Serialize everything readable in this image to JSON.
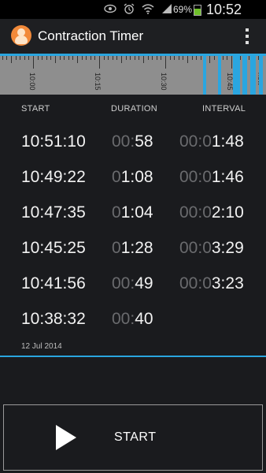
{
  "status_bar": {
    "battery_pct": "69%",
    "time": "10:52 AM",
    "battery_level": 0.69,
    "icons": [
      "eye-icon",
      "alarm-icon",
      "wifi-icon",
      "signal-icon",
      "battery-icon"
    ]
  },
  "action_bar": {
    "title": "Contraction Timer",
    "logo": "pregnant-woman-logo",
    "menu_icon": "overflow-menu-icon"
  },
  "timeline": {
    "labels": [
      "10:00",
      "10:15",
      "10:30",
      "10:45",
      "now"
    ],
    "accent": "#2aa6e0",
    "background": "#8e8e8e"
  },
  "table": {
    "headers": {
      "start": "START",
      "duration": "DURATION",
      "interval": "INTERVAL"
    },
    "rows": [
      {
        "start": "10:51:10",
        "duration_dim": "00:",
        "duration": "58",
        "interval_dim": "00:0",
        "interval": "1:48"
      },
      {
        "start": "10:49:22",
        "duration_dim": "0",
        "duration": "1:08",
        "interval_dim": "00:0",
        "interval": "1:46"
      },
      {
        "start": "10:47:35",
        "duration_dim": "0",
        "duration": "1:04",
        "interval_dim": "00:0",
        "interval": "2:10"
      },
      {
        "start": "10:45:25",
        "duration_dim": "0",
        "duration": "1:28",
        "interval_dim": "00:0",
        "interval": "3:29"
      },
      {
        "start": "10:41:56",
        "duration_dim": "00:",
        "duration": "49",
        "interval_dim": "00:0",
        "interval": "3:23"
      },
      {
        "start": "10:38:32",
        "duration_dim": "00:",
        "duration": "40",
        "interval_dim": "",
        "interval": ""
      }
    ],
    "date": "12 Jul 2014"
  },
  "start_button": {
    "label": "START",
    "icon": "play-icon"
  }
}
